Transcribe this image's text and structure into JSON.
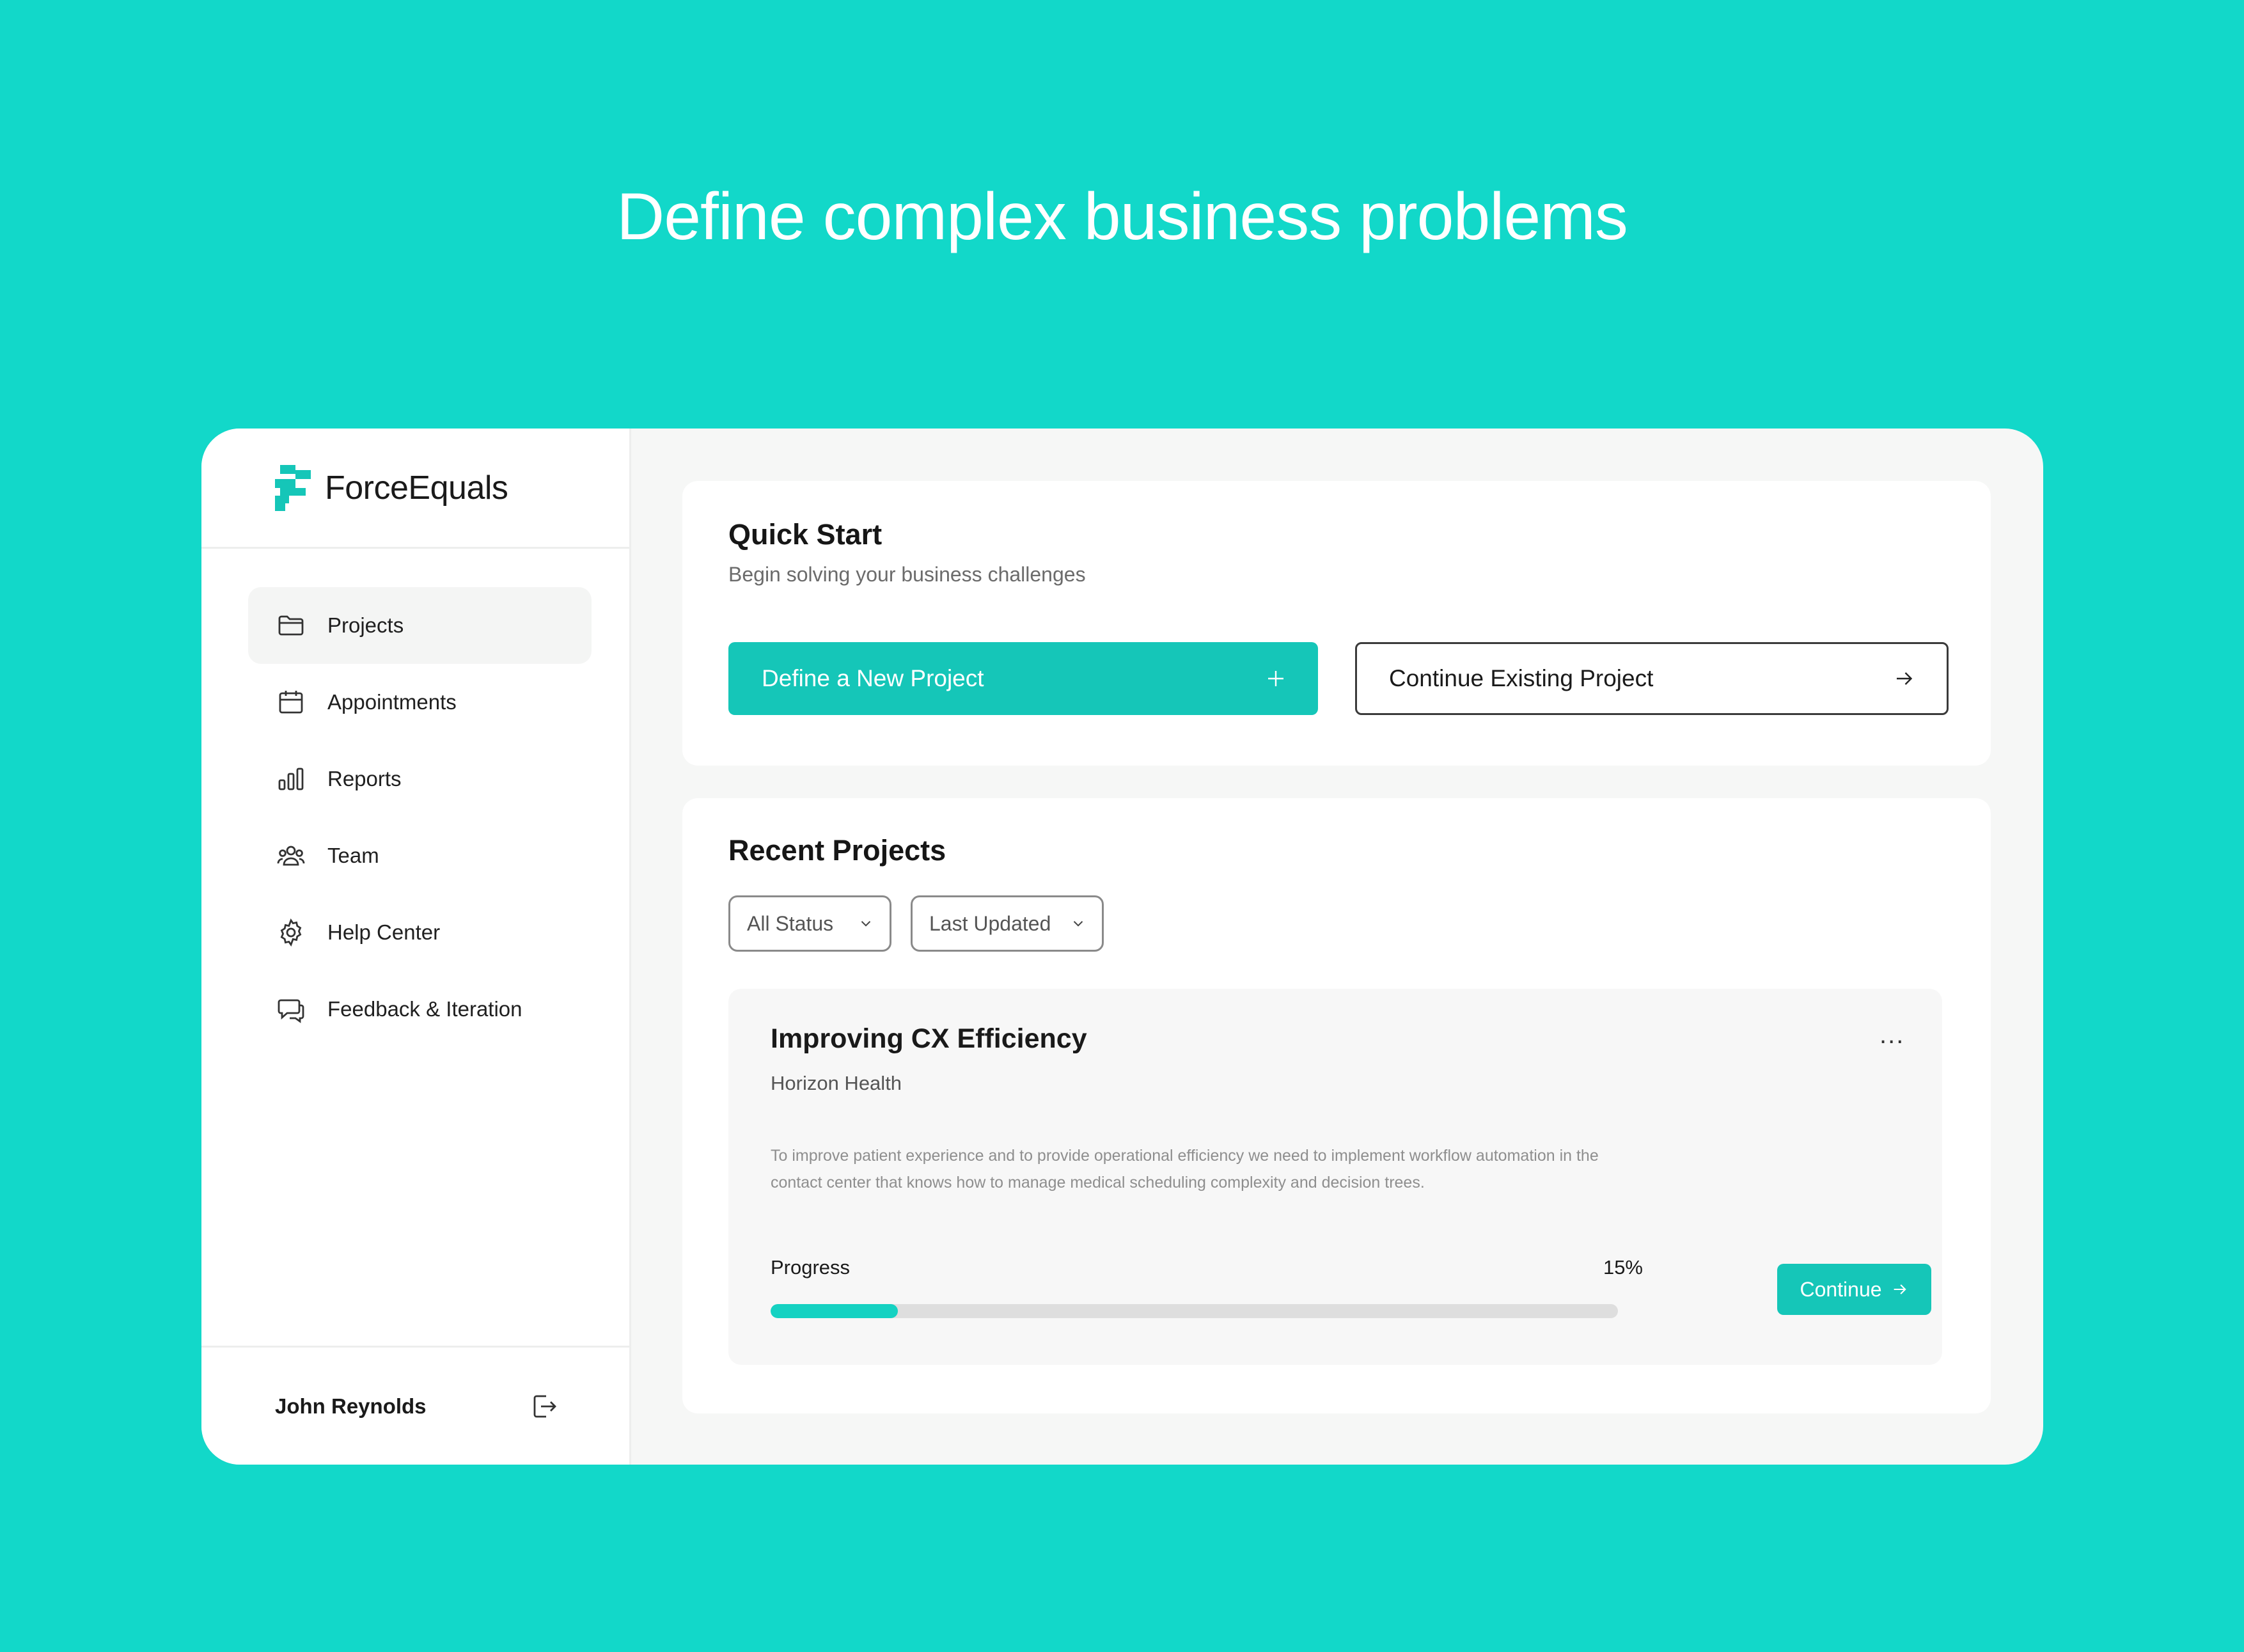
{
  "headline": "Define complex business problems",
  "brand": {
    "name": "ForceEquals",
    "accent": "#15C6B8"
  },
  "sidebar": {
    "items": [
      {
        "label": "Projects",
        "icon": "folder-icon",
        "active": true
      },
      {
        "label": "Appointments",
        "icon": "calendar-icon",
        "active": false
      },
      {
        "label": "Reports",
        "icon": "bar-chart-icon",
        "active": false
      },
      {
        "label": "Team",
        "icon": "team-icon",
        "active": false
      },
      {
        "label": "Help Center",
        "icon": "gear-icon",
        "active": false
      },
      {
        "label": "Feedback & Iteration",
        "icon": "chat-icon",
        "active": false
      }
    ],
    "user_name": "John Reynolds"
  },
  "quick_start": {
    "title": "Quick Start",
    "subtitle": "Begin solving your business challenges",
    "new_project_label": "Define a New Project",
    "continue_label": "Continue Existing Project"
  },
  "recent": {
    "title": "Recent Projects",
    "filters": {
      "status": "All Status",
      "sort": "Last Updated"
    },
    "project": {
      "title": "Improving CX Efficiency",
      "client": "Horizon Health",
      "description": "To improve patient experience and to provide operational efficiency we need to implement workflow automation in the contact center that knows how to manage medical scheduling complexity and decision trees.",
      "progress_label": "Progress",
      "progress_text": "15%",
      "progress_value": 0.15,
      "continue_label": "Continue",
      "more_label": "..."
    }
  },
  "colors": {
    "background": "#12D8C9",
    "primary": "#15C6B8",
    "progress": "#15D2C2"
  }
}
